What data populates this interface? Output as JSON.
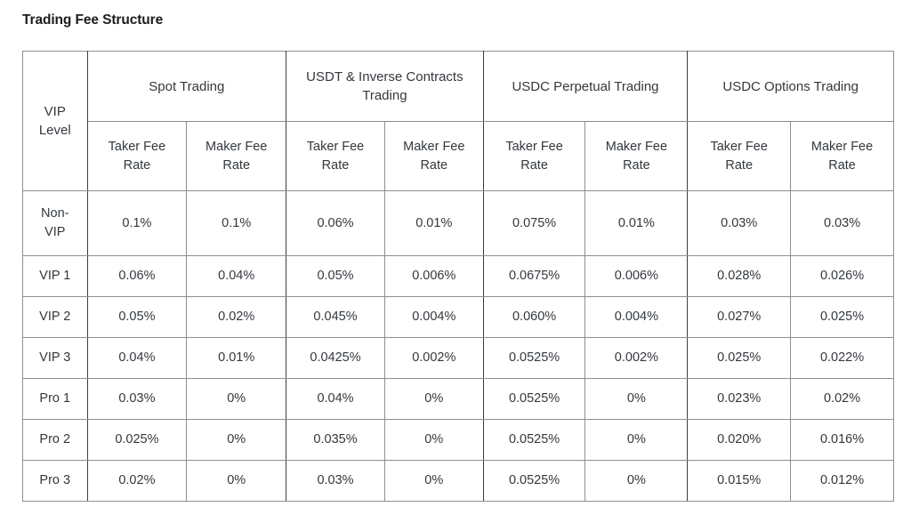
{
  "page": {
    "title": "Trading Fee Structure",
    "background_color": "#ffffff",
    "text_color": "#33383d",
    "border_color": "#3a3d41"
  },
  "table": {
    "corner_header": "VIP\nLevel",
    "corner_header_line1": "VIP",
    "corner_header_line2": "Level",
    "groups": [
      {
        "label": "Spot Trading",
        "subcolumns": [
          "Taker Fee Rate",
          "Maker Fee Rate"
        ]
      },
      {
        "label": "USDT & Inverse Contracts Trading",
        "subcolumns": [
          "Taker Fee Rate",
          "Maker Fee Rate"
        ]
      },
      {
        "label": "USDC Perpetual Trading",
        "subcolumns": [
          "Taker Fee Rate",
          "Maker Fee Rate"
        ]
      },
      {
        "label": "USDC Options Trading",
        "subcolumns": [
          "Taker Fee Rate",
          "Maker Fee Rate"
        ]
      }
    ],
    "subheader_line1": "Taker Fee",
    "subheader_line2": "Rate",
    "subheader_maker_line1": "Maker Fee",
    "subheader_maker_line2": "Rate",
    "rows": [
      {
        "level": "Non-VIP",
        "level_line1": "Non-",
        "level_line2": "VIP",
        "values": [
          "0.1%",
          "0.1%",
          "0.06%",
          "0.01%",
          "0.075%",
          "0.01%",
          "0.03%",
          "0.03%"
        ]
      },
      {
        "level": "VIP 1",
        "values": [
          "0.06%",
          "0.04%",
          "0.05%",
          "0.006%",
          "0.0675%",
          "0.006%",
          "0.028%",
          "0.026%"
        ]
      },
      {
        "level": "VIP 2",
        "values": [
          "0.05%",
          "0.02%",
          "0.045%",
          "0.004%",
          "0.060%",
          "0.004%",
          "0.027%",
          "0.025%"
        ]
      },
      {
        "level": "VIP 3",
        "values": [
          "0.04%",
          "0.01%",
          "0.0425%",
          "0.002%",
          "0.0525%",
          "0.002%",
          "0.025%",
          "0.022%"
        ]
      },
      {
        "level": "Pro 1",
        "values": [
          "0.03%",
          "0%",
          "0.04%",
          "0%",
          "0.0525%",
          "0%",
          "0.023%",
          "0.02%"
        ]
      },
      {
        "level": "Pro 2",
        "values": [
          "0.025%",
          "0%",
          "0.035%",
          "0%",
          "0.0525%",
          "0%",
          "0.020%",
          "0.016%"
        ]
      },
      {
        "level": "Pro 3",
        "values": [
          "0.02%",
          "0%",
          "0.03%",
          "0%",
          "0.0525%",
          "0%",
          "0.015%",
          "0.012%"
        ]
      }
    ]
  }
}
